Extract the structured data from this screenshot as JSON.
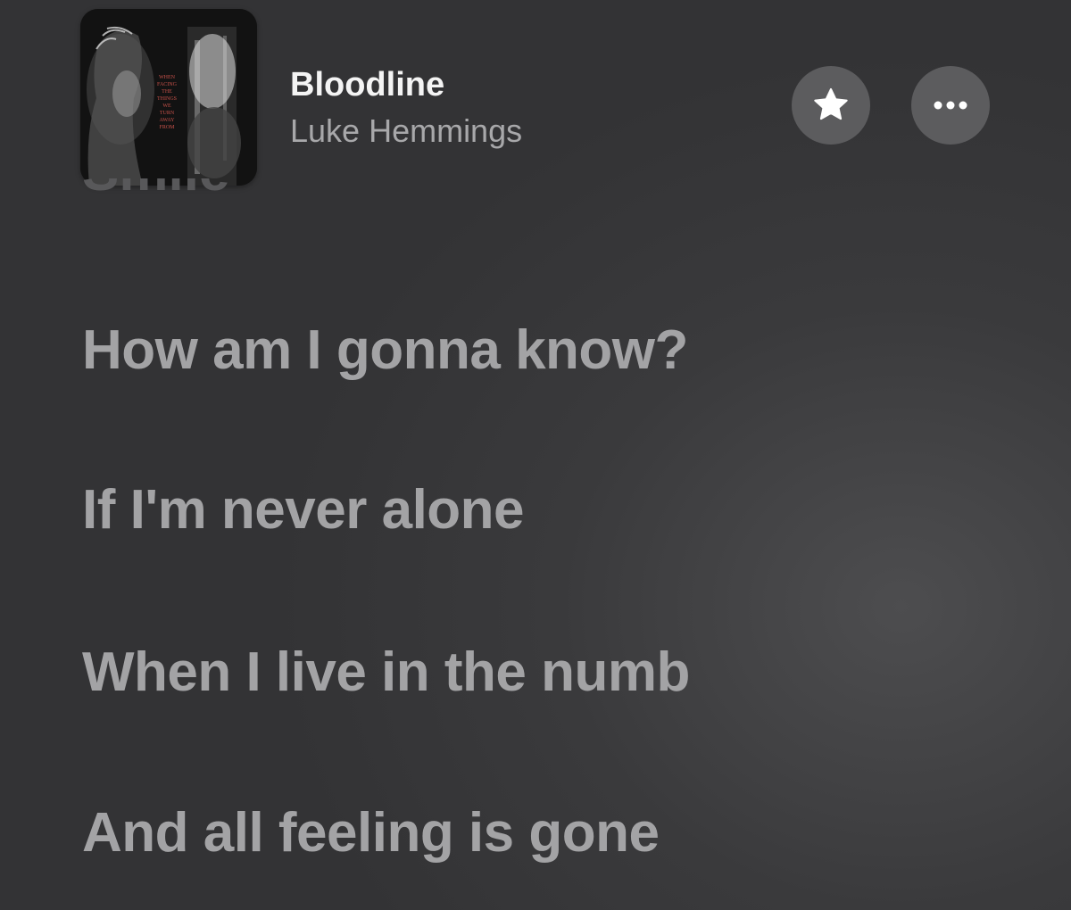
{
  "now_playing": {
    "title": "Bloodline",
    "artist": "Luke Hemmings",
    "album_cover_text": "WHEN FACING THE THINGS WE TURN AWAY FROM"
  },
  "actions": {
    "favorite_icon": "star-icon",
    "more_icon": "ellipsis-icon"
  },
  "lyrics": {
    "previous_line_partial": "Smile",
    "lines": [
      "How am I gonna know?",
      "If I'm never alone",
      "When I live in the numb",
      "And all feeling is gone"
    ]
  },
  "colors": {
    "background": "#3a3a3c",
    "lyric_text": "#a3a3a5",
    "title_text": "#f4f4f4",
    "artist_text": "#a8a8aa",
    "button_bg": "#5c5c5e"
  }
}
